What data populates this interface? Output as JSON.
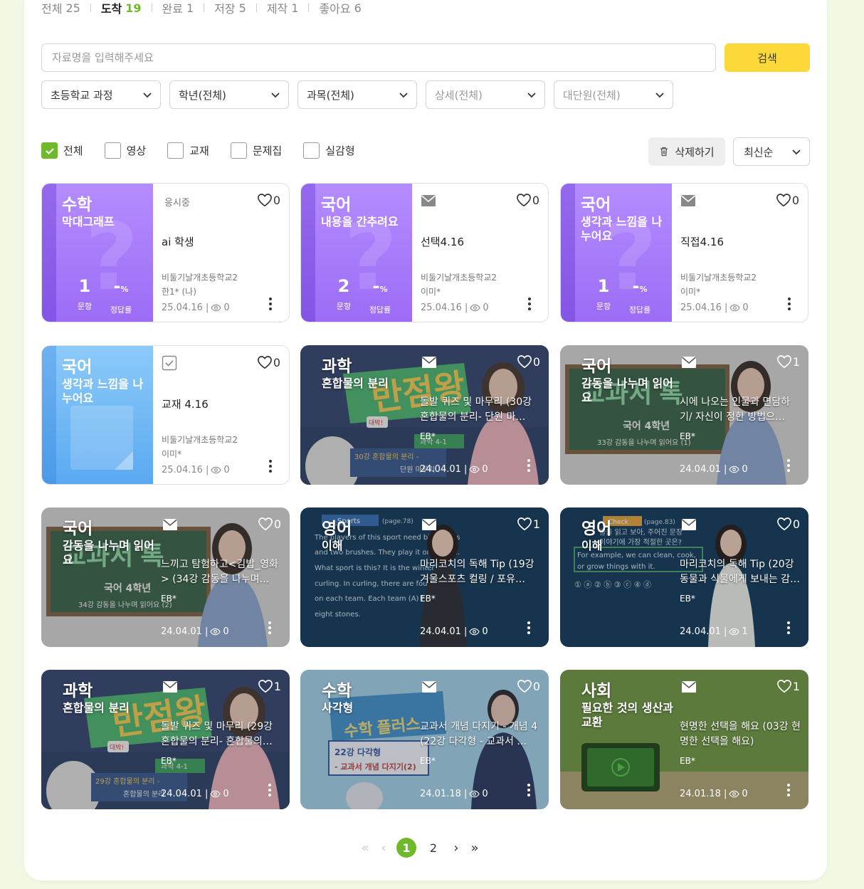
{
  "tabs": [
    {
      "label": "전체",
      "count": "25"
    },
    {
      "label": "도착",
      "count": "19"
    },
    {
      "label": "완료",
      "count": "1"
    },
    {
      "label": "저장",
      "count": "5"
    },
    {
      "label": "제작",
      "count": "1"
    },
    {
      "label": "좋아요",
      "count": "6"
    }
  ],
  "active_tab": "도착",
  "search": {
    "placeholder": "자료명을 입력해주세요",
    "value": "",
    "button_label": "검색"
  },
  "selects": [
    "초등학교 과정",
    "학년(전체)",
    "과목(전체)",
    "상세(전체)",
    "대단원(전체)"
  ],
  "filters": [
    {
      "label": "전체",
      "checked": true
    },
    {
      "label": "영상",
      "checked": false
    },
    {
      "label": "교재",
      "checked": false
    },
    {
      "label": "문제집",
      "checked": false
    },
    {
      "label": "실감형",
      "checked": false
    }
  ],
  "delete_label": "삭제하기",
  "sort_label": "최신순",
  "cards": [
    {
      "subject": "수학",
      "topic": "막대그래프",
      "status": "응시중",
      "likes": "0",
      "title": "ai 학생",
      "school": "비둘기날개초등학교2",
      "author": "한1* (나)",
      "date": "25.04.16",
      "views": "0",
      "count": "1",
      "rate": "-",
      "count_label": "문항",
      "rate_label": "정답률",
      "pct": "%"
    },
    {
      "subject": "국어",
      "topic": "내용을 간추려요",
      "likes": "0",
      "title": "선택4.16",
      "school": "비둘기날개초등학교2",
      "author": "이미*",
      "date": "25.04.16",
      "views": "0",
      "count": "2",
      "rate": "-",
      "count_label": "문항",
      "rate_label": "정답률",
      "pct": "%"
    },
    {
      "subject": "국어",
      "topic": "생각과 느낌을 나누어요",
      "likes": "0",
      "title": "직접4.16",
      "school": "비둘기날개초등학교2",
      "author": "이미*",
      "date": "25.04.16",
      "views": "0",
      "count": "1",
      "rate": "-",
      "count_label": "문항",
      "rate_label": "정답률",
      "pct": "%"
    },
    {
      "subject": "국어",
      "topic": "생각과 느낌을 나누어요",
      "likes": "0",
      "title": "교재 4.16",
      "school": "비둘기날개초등학교2",
      "author": "이미*",
      "date": "25.04.16",
      "views": "0"
    },
    {
      "subject": "과학",
      "topic": "혼합물의 분리",
      "likes": "0",
      "title": "돌발 퀴즈 및 마무리 (30강 혼합물의 분리- 단원 마…",
      "school": "EB*",
      "date": "24.04.01",
      "views": "0"
    },
    {
      "subject": "국어",
      "topic": "감동을 나누며 읽어요",
      "likes": "1",
      "title": "시에 나오는 인물과 면담하기/ 자신이 정한 방법으…",
      "school": "EB*",
      "date": "24.04.01",
      "views": "0"
    },
    {
      "subject": "국어",
      "topic": "감동을 나누며 읽어요",
      "likes": "0",
      "title": "느끼고 탐험하고<김밥_영화> (34강 감동을 나누며…",
      "school": "EB*",
      "date": "24.04.01",
      "views": "0"
    },
    {
      "subject": "영어",
      "topic": "이해",
      "likes": "1",
      "title": "마리코치의 독해 Tip (19강 겨울스포츠 컬링 / 포유…",
      "school": "EB*",
      "date": "24.04.01",
      "views": "0"
    },
    {
      "subject": "영어",
      "topic": "이해",
      "likes": "0",
      "title": "마리코치의 독해 Tip (20강 동물과 식물에게 보내는 감…",
      "school": "EB*",
      "date": "24.04.01",
      "views": "1"
    },
    {
      "subject": "과학",
      "topic": "혼합물의 분리",
      "likes": "1",
      "title": "돌발 퀴즈 및 마무리 (29강 혼합물의 분리- 혼합물의…",
      "school": "EB*",
      "date": "24.04.01",
      "views": "0"
    },
    {
      "subject": "수학",
      "topic": "사각형",
      "likes": "0",
      "title": "교과서 개념 다지기 - 개념 4 (22강 다각형 - 교과서 …",
      "school": "EB*",
      "date": "24.01.18",
      "views": "0"
    },
    {
      "subject": "사회",
      "topic": "필요한 것의 생산과 교환",
      "likes": "1",
      "title": "현명한 선택을 해요 (03강 현명한 선택을 해요)",
      "school": "EB*",
      "date": "24.01.18",
      "views": "0"
    }
  ],
  "thumbnail_text": {
    "science_badge": "대박!",
    "science_grade": "과학 4-1",
    "sci30_line1": "30강 혼합물의 분리 -",
    "sci30_line2": "단원 마무리",
    "sci29_line1": "29강 혼합물의 분리 -",
    "sci29_line2": "혼합물의 분리",
    "kor_logo": "교과서 톡",
    "kor_grade": "국어 4학년",
    "kor33": "33강 감동을 나누며 읽어요 (1)",
    "kor34": "34강 감동을 나누며 읽어요 (2)",
    "eng19_header": "Sports",
    "eng19_page": "(page.78)",
    "eng19_lines": [
      "The players of this sport need big stones",
      "and two brushes. They play it on the ice.",
      "What sport is this? It is the winter",
      "curling. In curling, there are four",
      "on each team. Each team (A) has",
      "eight stones."
    ],
    "eng20_header": "Check",
    "eng20_page": "(page.83)",
    "eng20_lines": [
      "글을 읽고 보아, 주어진 문장",
      "이야기에 가장 적절한 곳은?",
      "For example, we can clean, cook,",
      "or grow things with it.",
      "① ⓐ   ② ⓑ   ③ ⓒ   ④ ⓓ"
    ],
    "math_logo": "수학 플러스",
    "math_line1": "22강 다각형",
    "math_line2": "- 교과서 개념 다지기(2)"
  },
  "pagination": {
    "pages": [
      "1",
      "2"
    ],
    "current": "1"
  },
  "colors": {
    "accent": "#6fba2c",
    "search_button": "#fcd939",
    "purple": "#a77bf9",
    "blue": "#6ab4f5",
    "society": "#5c7a3c"
  }
}
